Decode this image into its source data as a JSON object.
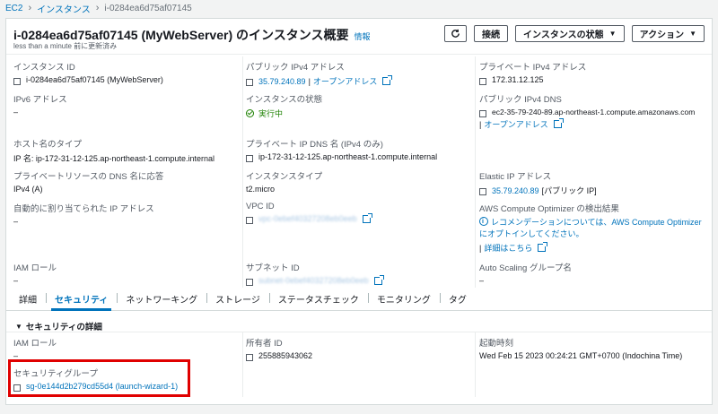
{
  "breadcrumb": {
    "root": "EC2",
    "instances": "インスタンス",
    "current": "i-0284ea6d75af07145"
  },
  "header": {
    "title": "i-0284ea6d75af07145 (MyWebServer) のインスタンス概要",
    "info": "情報",
    "updated": "less than a minute 前に更新済み",
    "connect": "接続",
    "state": "インスタンスの状態",
    "actions": "アクション"
  },
  "summary": {
    "instance_id": {
      "label": "インスタンス ID",
      "value": "i-0284ea6d75af07145 (MyWebServer)"
    },
    "public_ip": {
      "label": "パブリック IPv4 アドレス",
      "ip": "35.79.240.89",
      "open": "オープンアドレス"
    },
    "private_ip": {
      "label": "プライベート IPv4 アドレス",
      "value": "172.31.12.125"
    },
    "ipv6": {
      "label": "IPv6 アドレス",
      "value": "–"
    },
    "state": {
      "label": "インスタンスの状態",
      "value": "実行中"
    },
    "public_dns": {
      "label": "パブリック IPv4 DNS",
      "value": "ec2-35-79-240-89.ap-northeast-1.compute.amazonaws.com",
      "pipe": "|",
      "open": "オープンアドレス"
    },
    "hostname_type": {
      "label": "ホスト名のタイプ",
      "value": "IP 名: ip-172-31-12-125.ap-northeast-1.compute.internal"
    },
    "private_dns_name": {
      "label": "プライベート IP DNS 名 (IPv4 のみ)",
      "value": "ip-172-31-12-125.ap-northeast-1.compute.internal"
    },
    "resource_dns": {
      "label": "プライベートリソースの DNS 名に応答",
      "value": "IPv4 (A)"
    },
    "instance_type": {
      "label": "インスタンスタイプ",
      "value": "t2.micro"
    },
    "elastic_ip": {
      "label": "Elastic IP アドレス",
      "ip": "35.79.240.89",
      "suffix": "[パブリック IP]"
    },
    "auto_ip": {
      "label": "自動的に割り当てられた IP アドレス",
      "value": "–"
    },
    "vpc": {
      "label": "VPC ID",
      "value": "vpc-0ebef40327208eb0eeb"
    },
    "optimizer": {
      "label": "AWS Compute Optimizer の検出結果",
      "text": "レコメンデーションについては、AWS Compute Optimizer にオプトインしてください。",
      "detail": "詳細はこちら"
    },
    "iam": {
      "label": "IAM ロール",
      "value": "–"
    },
    "subnet": {
      "label": "サブネット ID",
      "value": "subnet-0ebef40327208eb0eeb"
    },
    "asg": {
      "label": "Auto Scaling グループ名",
      "value": "–"
    }
  },
  "tabs": [
    "詳細",
    "セキュリティ",
    "ネットワーキング",
    "ストレージ",
    "ステータスチェック",
    "モニタリング",
    "タグ"
  ],
  "security": {
    "title": "セキュリティの詳細",
    "iam": {
      "label": "IAM ロール",
      "value": "–"
    },
    "owner": {
      "label": "所有者 ID",
      "value": "255885943062"
    },
    "launch": {
      "label": "起動時刻",
      "value": "Wed Feb 15 2023 00:24:21 GMT+0700 (Indochina Time)"
    },
    "sg": {
      "label": "セキュリティグループ",
      "value": "sg-0e144d2b279cd55d4 (launch-wizard-1)"
    }
  }
}
